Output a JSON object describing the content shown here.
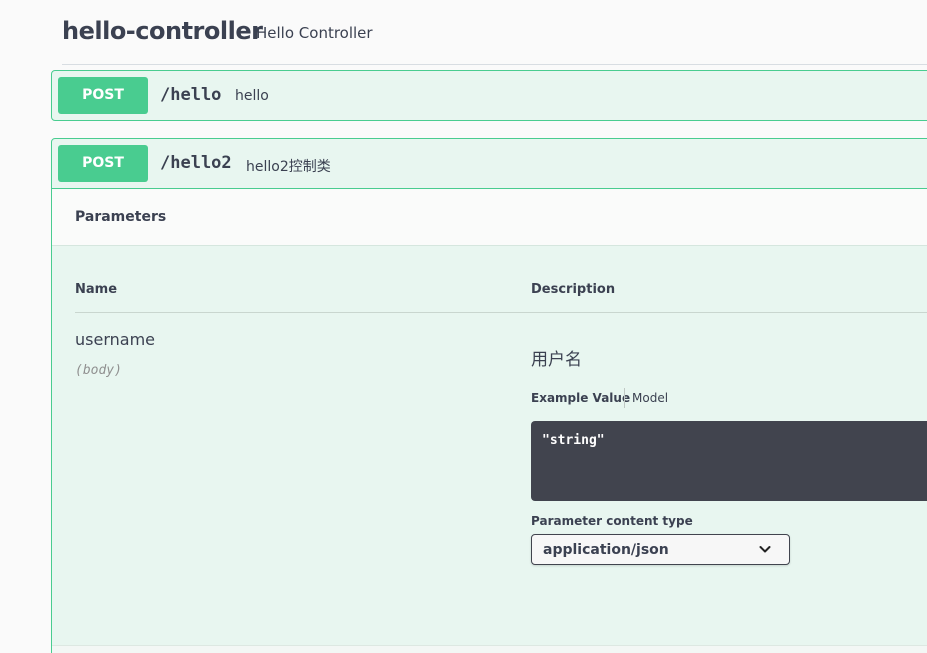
{
  "tag": {
    "title": "hello-controller",
    "description": "Hello Controller"
  },
  "operations": [
    {
      "method": "POST",
      "path": "/hello",
      "summary": "hello",
      "color": "#49cc90"
    },
    {
      "method": "POST",
      "path": "/hello2",
      "summary": "hello2控制类",
      "color": "#49cc90",
      "parameters_title": "Parameters",
      "columns": {
        "name": "Name",
        "description": "Description"
      },
      "parameter": {
        "name": "username",
        "in": "(body)",
        "description": "用户名",
        "tabs": {
          "example": "Example Value",
          "model": "Model"
        },
        "example_value": "\"string\"",
        "content_type_label": "Parameter content type",
        "content_type": "application/json",
        "content_type_icon": "chevron-down-icon"
      }
    }
  ]
}
